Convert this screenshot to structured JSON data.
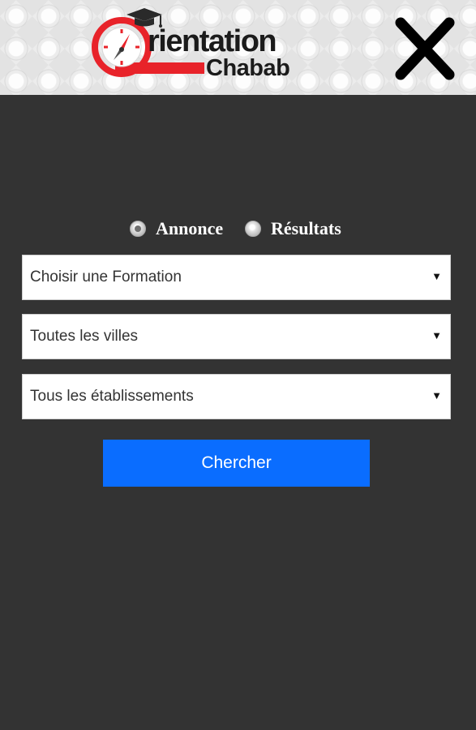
{
  "header": {
    "logo_word": "rientation",
    "logo_sub": "Chabab",
    "logo_icon": "compass-graduation-cap-icon",
    "close_icon": "close-icon"
  },
  "search_type": {
    "options": [
      {
        "label": "Annonce",
        "checked": true
      },
      {
        "label": "Résultats",
        "checked": false
      }
    ]
  },
  "filters": {
    "formation": "Choisir une Formation",
    "ville": "Toutes les villes",
    "etablissement": "Tous les établissements",
    "arrow": "▼"
  },
  "actions": {
    "search_label": "Chercher"
  },
  "colors": {
    "background": "#333333",
    "brand_red": "#e8232a",
    "button_blue": "#0a6dff"
  }
}
